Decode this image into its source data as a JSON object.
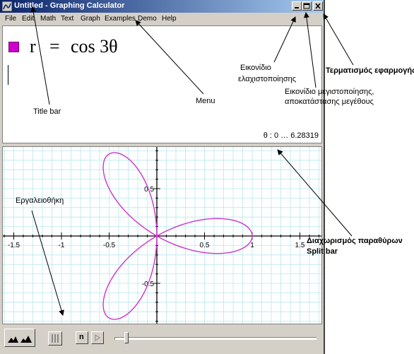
{
  "window": {
    "title": "Untitled - Graphing Calculator",
    "buttons": {
      "minimize": "_",
      "maximize": "□",
      "close": "✕"
    }
  },
  "menu": [
    "File",
    "Edit",
    "Math",
    "Text",
    "Graph",
    "Examples",
    "Demo",
    "Help"
  ],
  "equation": {
    "lhs": "r",
    "eq": "=",
    "rhs": "cos 3θ",
    "color": "#cc00cc"
  },
  "range_text": "θ : 0 … 6.28319",
  "graph": {
    "x_ticks": [
      "-1.5",
      "-1",
      "-0.5",
      "0.5",
      "1",
      "1.5"
    ],
    "y_ticks": [
      "0.5",
      "-0.5"
    ],
    "grid_color": "#b8e8f0",
    "curve_color": "#cc33cc"
  },
  "toolbar": {
    "n_label": "n"
  },
  "annotations": {
    "title_bar": "Title bar",
    "menu": "Menu",
    "minimize_gr_1": "Εικονίδιο",
    "minimize_gr_2": "ελαχιστοποίησης",
    "close_gr": "Τερματισμός εφαρμογής",
    "maximize_gr_1": "Εικονίδιο μεγιστοποίησης,",
    "maximize_gr_2": "αποκατάστασης μεγέθους",
    "toolbar_gr": "Εργαλειοθήκη",
    "split_gr": "Διαχωρισμός παραθύρων",
    "split_en": "Split bar"
  },
  "chart_data": {
    "type": "line",
    "title": "",
    "xlabel": "",
    "ylabel": "",
    "xlim": [
      -1.65,
      1.75
    ],
    "ylim": [
      -0.95,
      1.0
    ],
    "x_tick_values": [
      -1.5,
      -1,
      -0.5,
      0.5,
      1,
      1.5
    ],
    "y_tick_values": [
      0.5,
      -0.5
    ],
    "grid": true,
    "series": [
      {
        "polar": "r = cos(3θ)",
        "theta_range": [
          0,
          6.28319
        ],
        "x": [
          1.0,
          0.928,
          0.732,
          0.462,
          0.185,
          0.0,
          -0.047,
          -0.005,
          0.0,
          -0.141,
          -0.5,
          -0.744,
          -0.837,
          -0.744,
          -0.5,
          -0.141,
          0.0,
          -0.005,
          -0.047,
          0.0,
          0.185,
          0.462,
          0.732,
          0.928,
          1.0
        ],
        "y": [
          0.0,
          0.249,
          0.423,
          0.462,
          0.319,
          0.0,
          -0.177,
          -0.02,
          0.0,
          0.528,
          0.866,
          0.744,
          0.0,
          -0.744,
          -0.866,
          -0.528,
          0.0,
          0.02,
          0.177,
          0.0,
          -0.319,
          -0.462,
          -0.423,
          -0.249,
          0.0
        ]
      }
    ]
  }
}
